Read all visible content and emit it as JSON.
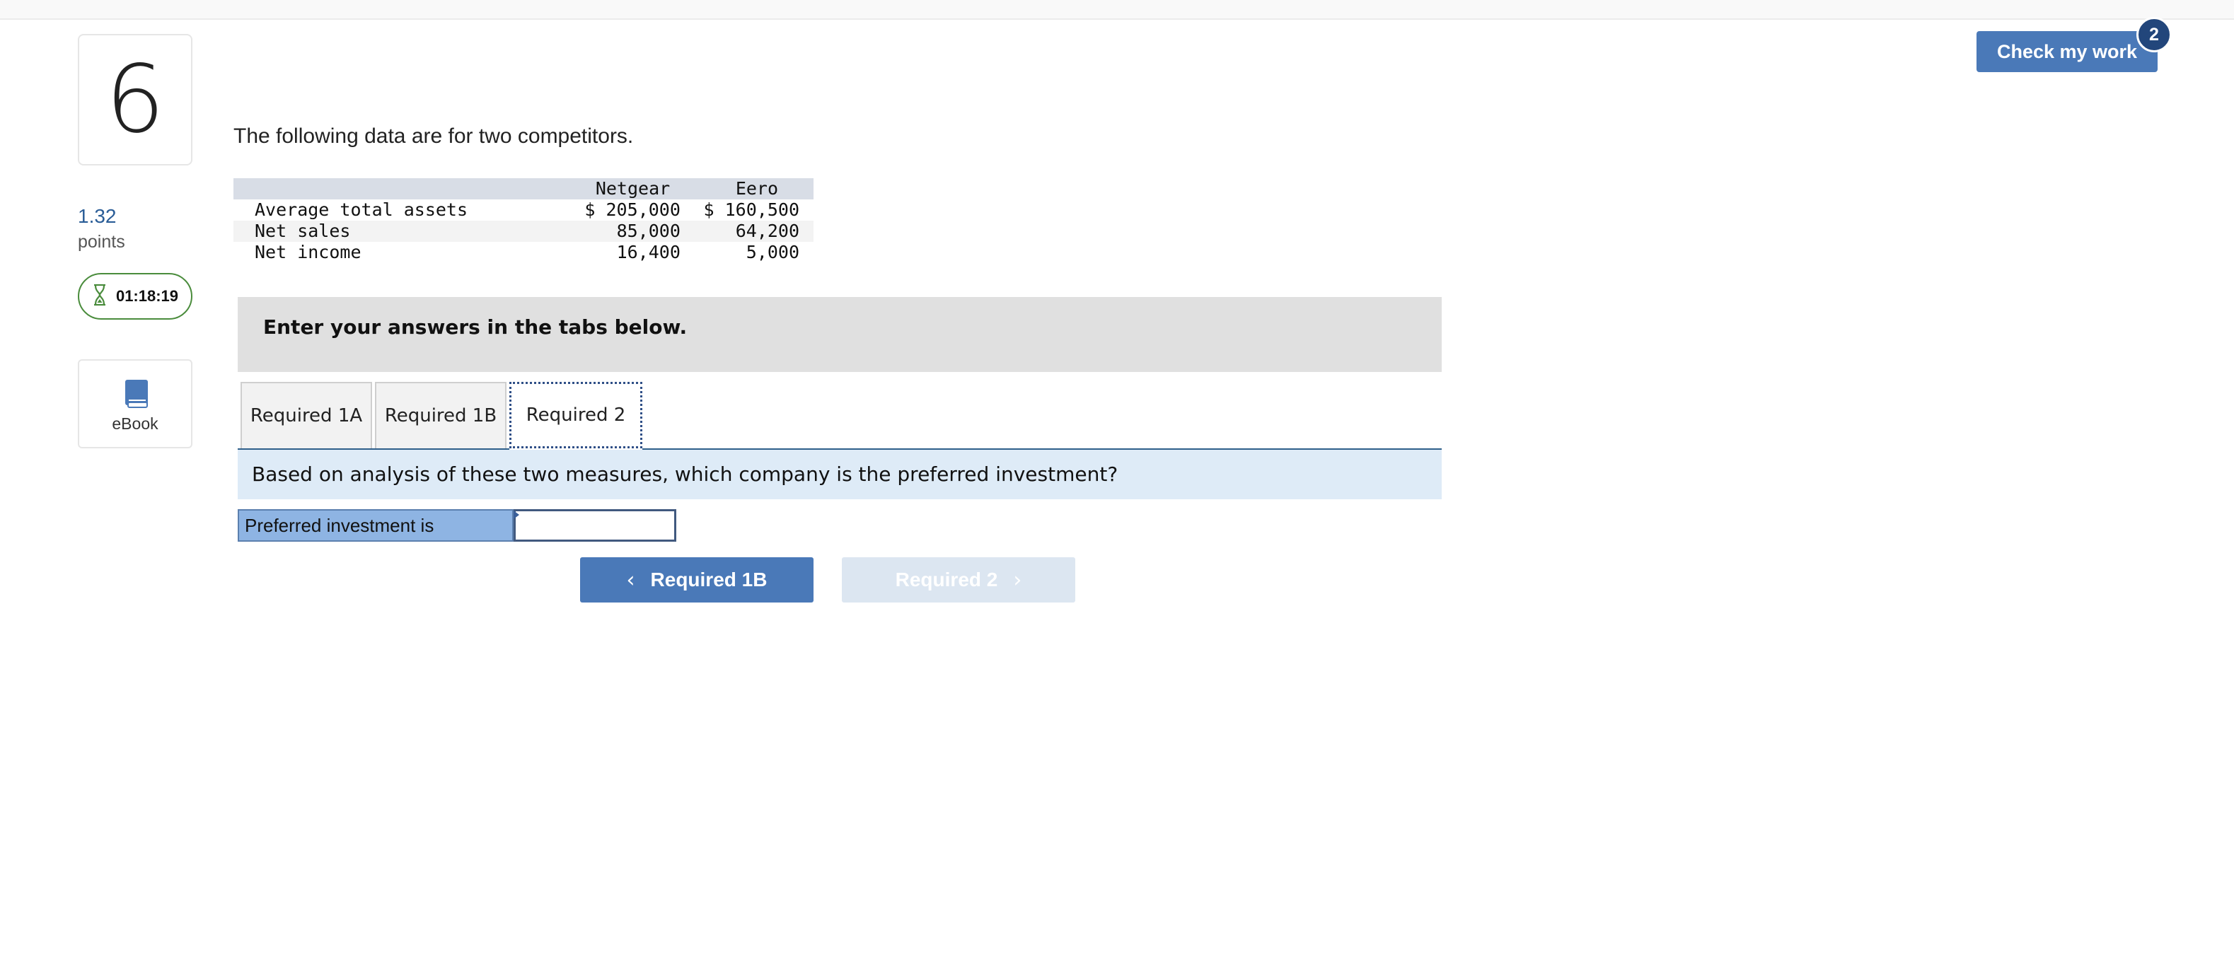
{
  "question": {
    "number": "6",
    "points_value": "1.32",
    "points_label": "points"
  },
  "timer": {
    "text": "01:18:19",
    "icon": "hourglass-icon"
  },
  "ebook": {
    "label": "eBook",
    "icon": "book-icon"
  },
  "check_work": {
    "label": "Check my work",
    "badge": "2"
  },
  "intro": "The following data are for two competitors.",
  "data_table": {
    "headers": [
      "",
      "Netgear",
      "Eero"
    ],
    "rows": [
      [
        "Average total assets",
        "$ 205,000",
        "$ 160,500"
      ],
      [
        "Net sales",
        "85,000",
        "64,200"
      ],
      [
        "Net income",
        "16,400",
        "5,000"
      ]
    ]
  },
  "instructions": "Enter your answers in the tabs below.",
  "tabs": [
    {
      "label": "Required 1A",
      "active": false
    },
    {
      "label": "Required 1B",
      "active": false
    },
    {
      "label": "Required 2",
      "active": true
    }
  ],
  "question_text": "Based on analysis of these two measures, which company is the preferred investment?",
  "answer": {
    "label": "Preferred investment is",
    "value": ""
  },
  "nav": {
    "prev_label": "Required 1B",
    "next_label": "Required 2"
  },
  "colors": {
    "primary": "#4a79b8",
    "badge": "#22467b",
    "timer_border": "#4a8c3c",
    "question_bg": "#deebf7",
    "answer_label_bg": "#8eb4e3",
    "disabled_bg": "#dce6f1"
  }
}
